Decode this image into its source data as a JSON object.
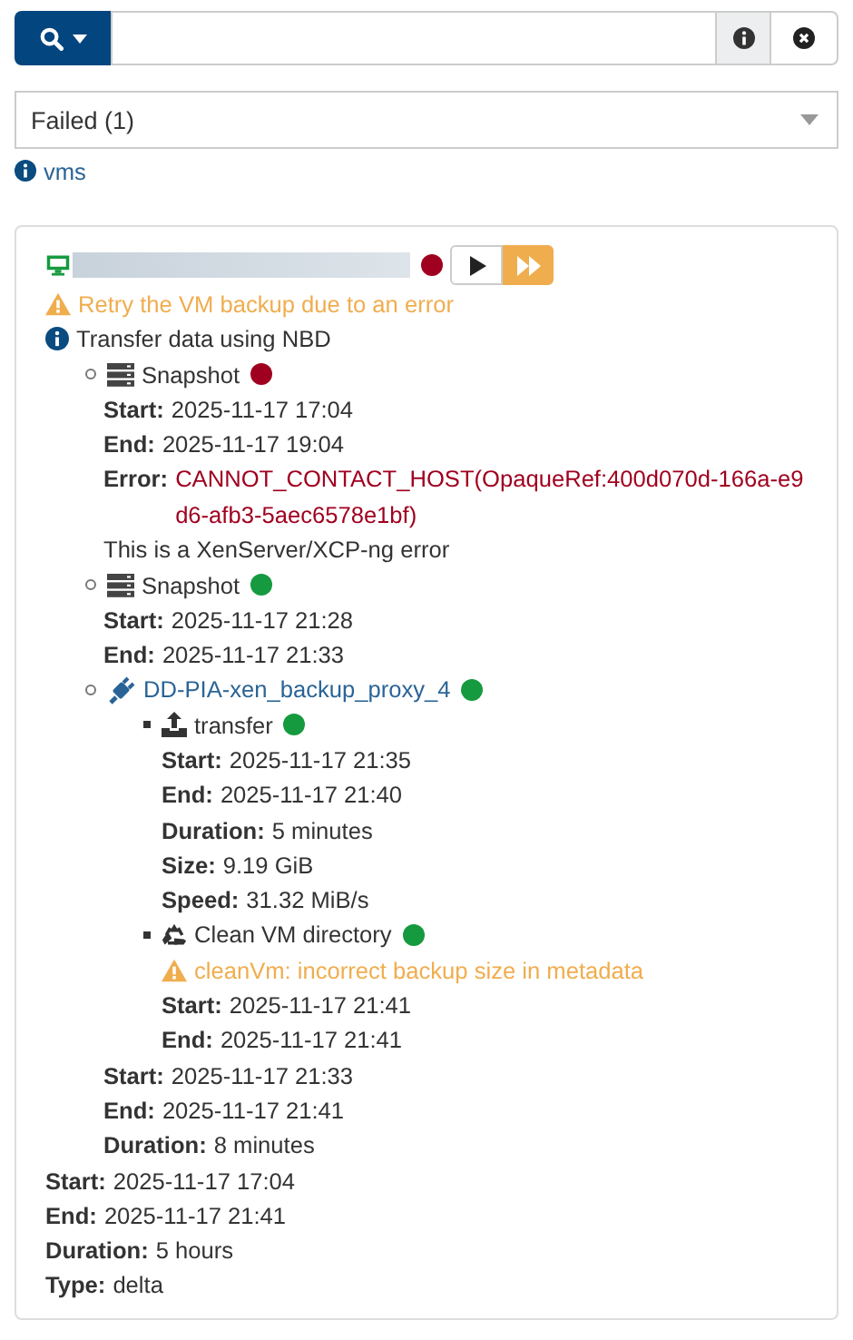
{
  "filter": {
    "value": "Failed (1)"
  },
  "filter_link": "vms",
  "vm": {
    "color": "#a0001f",
    "actions": [
      {
        "kind": "play"
      },
      {
        "kind": "fast-forward"
      }
    ],
    "notices": [
      {
        "kind": "warning",
        "text": "Retry the VM backup due to an error"
      },
      {
        "kind": "info",
        "text": "Transfer data using NBD"
      }
    ],
    "tasks": [
      {
        "kind": "snapshot",
        "name": "Snapshot",
        "link": false,
        "color": "#a0001f",
        "fields": [
          {
            "kind": "field",
            "label": "Start:",
            "value": "2025-11-17 17:04"
          },
          {
            "kind": "field",
            "label": "End:",
            "value": "2025-11-17 19:04"
          },
          {
            "kind": "error",
            "label": "Error:",
            "value": "CANNOT_CONTACT_HOST(OpaqueRef:400d070d-166a-e9d6-afb3-5aec6578e1bf)"
          },
          {
            "kind": "note",
            "value": "This is a XenServer/XCP-ng error"
          }
        ]
      },
      {
        "kind": "snapshot",
        "name": "Snapshot",
        "link": false,
        "color": "#169a3f",
        "fields": [
          {
            "kind": "field",
            "label": "Start:",
            "value": "2025-11-17 21:28"
          },
          {
            "kind": "field",
            "label": "End:",
            "value": "2025-11-17 21:33"
          }
        ]
      },
      {
        "kind": "remote",
        "name": "DD-PIA-xen_backup_proxy_4",
        "link": true,
        "color": "#169a3f",
        "children": [
          {
            "kind": "transfer",
            "name": "transfer",
            "color": "#169a3f",
            "fields": [
              {
                "kind": "field",
                "label": "Start:",
                "value": "2025-11-17 21:35"
              },
              {
                "kind": "field",
                "label": "End:",
                "value": "2025-11-17 21:40"
              },
              {
                "kind": "field",
                "label": "Duration:",
                "value": "5 minutes"
              },
              {
                "kind": "field",
                "label": "Size:",
                "value": "9.19 GiB"
              },
              {
                "kind": "field",
                "label": "Speed:",
                "value": "31.32 MiB/s"
              }
            ]
          },
          {
            "kind": "clean",
            "name": "Clean VM directory",
            "color": "#169a3f",
            "notices": [
              {
                "kind": "warning",
                "text": "cleanVm: incorrect backup size in metadata"
              }
            ],
            "fields": [
              {
                "kind": "field",
                "label": "Start:",
                "value": "2025-11-17 21:41"
              },
              {
                "kind": "field",
                "label": "End:",
                "value": "2025-11-17 21:41"
              }
            ]
          }
        ],
        "fields": [
          {
            "kind": "field",
            "label": "Start:",
            "value": "2025-11-17 21:33"
          },
          {
            "kind": "field",
            "label": "End:",
            "value": "2025-11-17 21:41"
          },
          {
            "kind": "field",
            "label": "Duration:",
            "value": "8 minutes"
          }
        ]
      }
    ],
    "fields": [
      {
        "kind": "field",
        "label": "Start:",
        "value": "2025-11-17 17:04"
      },
      {
        "kind": "field",
        "label": "End:",
        "value": "2025-11-17 21:41"
      },
      {
        "kind": "field",
        "label": "Duration:",
        "value": "5 hours"
      },
      {
        "kind": "field",
        "label": "Type:",
        "value": "delta"
      }
    ]
  }
}
